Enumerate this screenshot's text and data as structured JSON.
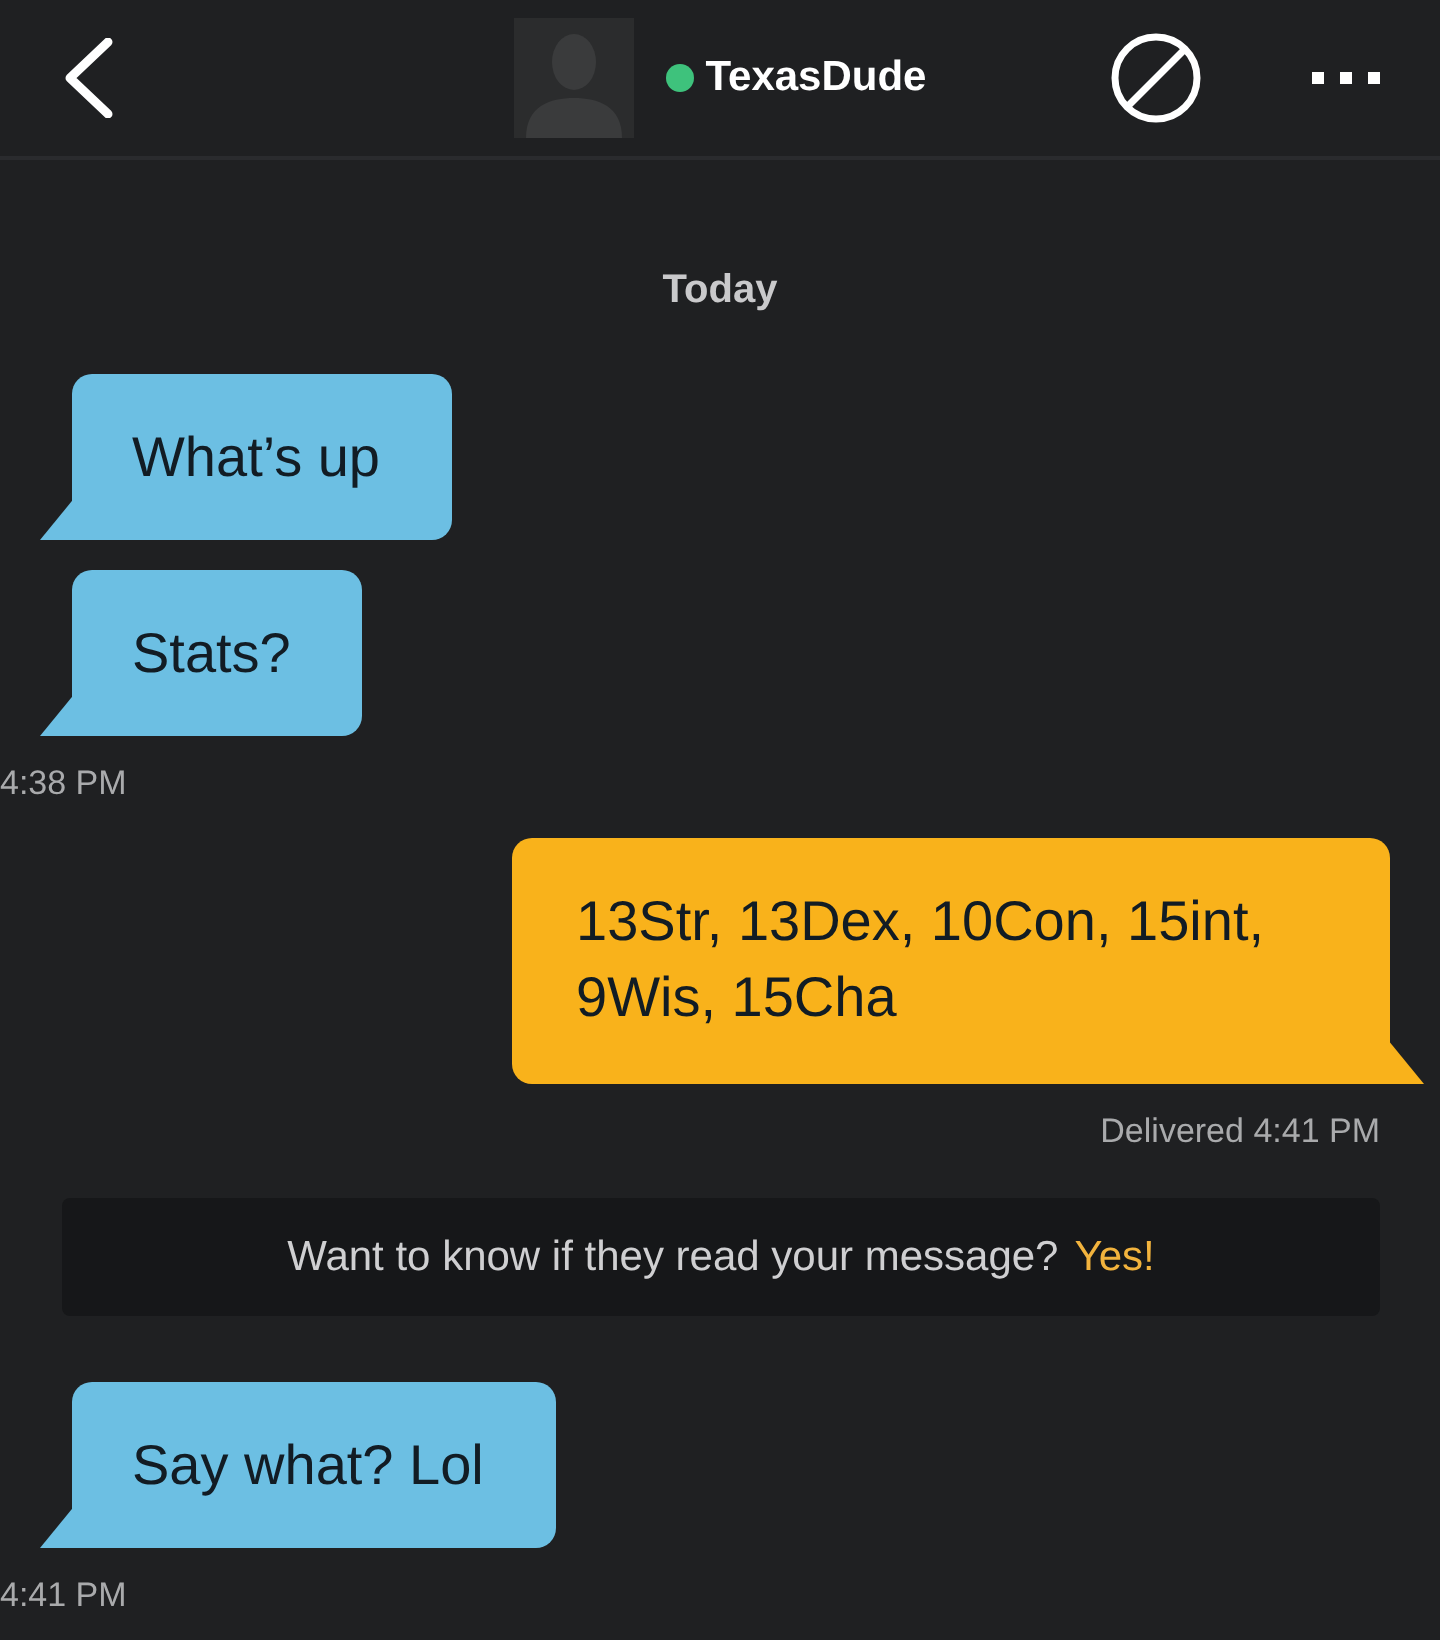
{
  "header": {
    "contact": {
      "name": "TexasDude",
      "online": true
    }
  },
  "thread": [
    {
      "kind": "day",
      "label": "Today"
    },
    {
      "kind": "incoming",
      "bubbles": [
        "What’s up",
        "Stats?"
      ],
      "footer": "4:38 PM"
    },
    {
      "kind": "outgoing",
      "bubbles": [
        "13Str, 13Dex, 10Con, 15int, 9Wis, 15Cha"
      ],
      "footer": "Delivered 4:41 PM"
    },
    {
      "kind": "prompt",
      "text": "Want to know if they read your message?",
      "action": "Yes!"
    },
    {
      "kind": "incoming",
      "bubbles": [
        "Say what? Lol"
      ],
      "footer": "4:41 PM"
    }
  ]
}
